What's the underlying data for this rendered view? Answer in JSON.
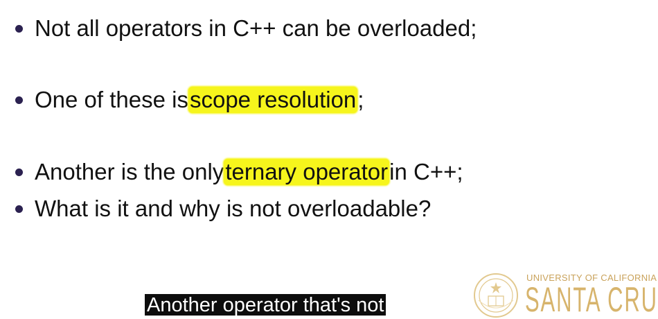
{
  "bullets": [
    {
      "before": "Not all operators in C++ can be overloaded;",
      "highlight": "",
      "after": ""
    },
    {
      "before": "One of these is ",
      "highlight": "scope resolution",
      "after": ";"
    },
    {
      "before": "Another is the only ",
      "highlight": "ternary operator",
      "after": " in C++;"
    },
    {
      "before": "What is it  and why is not overloadable?",
      "highlight": "",
      "after": ""
    }
  ],
  "caption": "Another operator that's not",
  "logo": {
    "top_text": "UNIVERSITY OF CALIFORNIA",
    "main_text": "SANTA CRUZ",
    "seal_icon": "uc-seal-icon"
  },
  "colors": {
    "bullet": "#2b2150",
    "highlight": "#f6f51c",
    "caption_bg": "#0d0d0d",
    "logo_gold": "#d7b46c"
  }
}
